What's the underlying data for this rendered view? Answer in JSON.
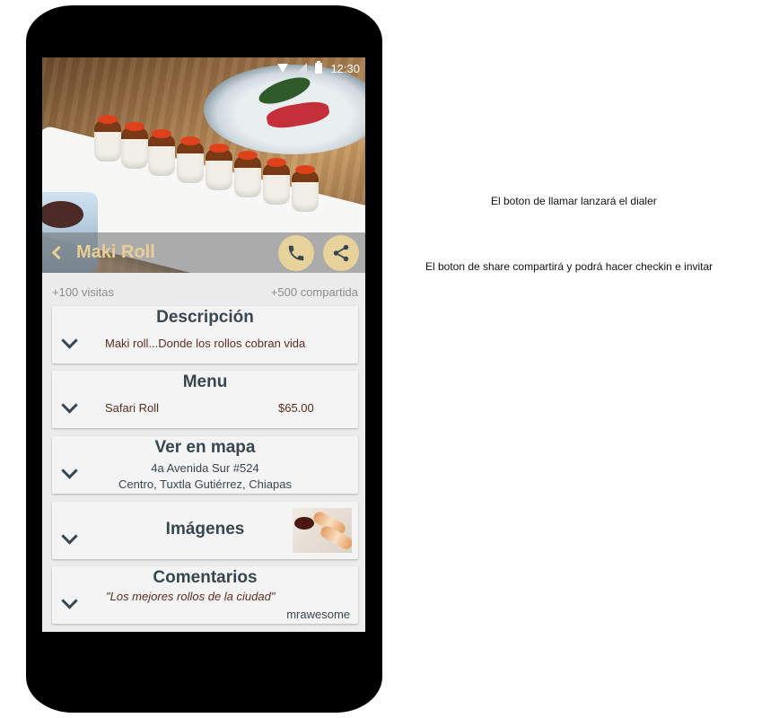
{
  "status_bar": {
    "time": "12:30"
  },
  "restaurant": {
    "title": "Maki Roll"
  },
  "stats": {
    "visits": "+100 visitas",
    "shares": "+500 compartida"
  },
  "cards": {
    "description": {
      "title": "Descripción",
      "text": "Maki roll...Donde los rollos cobran vida"
    },
    "menu": {
      "title": "Menu",
      "item_name": "Safari Roll",
      "item_price": "$65.00"
    },
    "map": {
      "title": "Ver en mapa",
      "address_line1": "4a Avenida Sur #524",
      "address_line2": "Centro, Tuxtla Gutiérrez, Chiapas"
    },
    "images": {
      "title": "Imágenes"
    },
    "comments": {
      "title": "Comentarios",
      "quote": "\"Los mejores rollos de la ciudad\"",
      "author": "mrawesome"
    }
  },
  "annotations": {
    "call_note": "El boton de llamar lanzará el dialer",
    "share_note": "El boton de share compartirá y podrá hacer checkin e invitar"
  },
  "colors": {
    "accent": "#e7d29b",
    "title_text": "#e9cf96",
    "card_title": "#38474f",
    "body_text": "#5a2d22"
  },
  "icons": [
    "wifi-icon",
    "signal-icon",
    "battery-icon",
    "back-icon",
    "phone-icon",
    "share-icon",
    "chevron-down-icon"
  ]
}
